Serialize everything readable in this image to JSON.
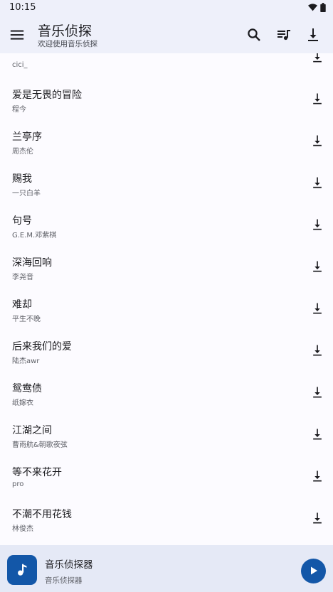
{
  "status": {
    "time": "10:15"
  },
  "app": {
    "title": "音乐侦探",
    "subtitle": "欢迎使用音乐侦探"
  },
  "songs": [
    {
      "title": "",
      "artist": "cici_"
    },
    {
      "title": "爱是无畏的冒险",
      "artist": "程今"
    },
    {
      "title": "兰亭序",
      "artist": "周杰伦"
    },
    {
      "title": "赐我",
      "artist": "一只白羊"
    },
    {
      "title": "句号",
      "artist": "G.E.M.邓紫棋"
    },
    {
      "title": "深海回响",
      "artist": "李尧音"
    },
    {
      "title": "难却",
      "artist": "平生不晚"
    },
    {
      "title": "后来我们的爱",
      "artist": "陆杰awr"
    },
    {
      "title": "鸳鸯债",
      "artist": "纸嫁衣"
    },
    {
      "title": "江湖之间",
      "artist": "曹雨航&朝歌夜弦"
    },
    {
      "title": "等不来花开",
      "artist": "pro"
    },
    {
      "title": "不潮不用花钱",
      "artist": "林俊杰"
    }
  ],
  "player": {
    "title": "音乐侦探器",
    "subtitle": "音乐侦探器"
  },
  "icons": {
    "menu": "menu-icon",
    "search": "search-icon",
    "queue": "queue-music-icon",
    "download": "download-icon",
    "play": "play-icon",
    "note": "music-note-icon"
  },
  "colors": {
    "appbar": "#eef0fa",
    "accent": "#1357a8",
    "background": "#fcfbff",
    "player": "#e5e9f6"
  }
}
